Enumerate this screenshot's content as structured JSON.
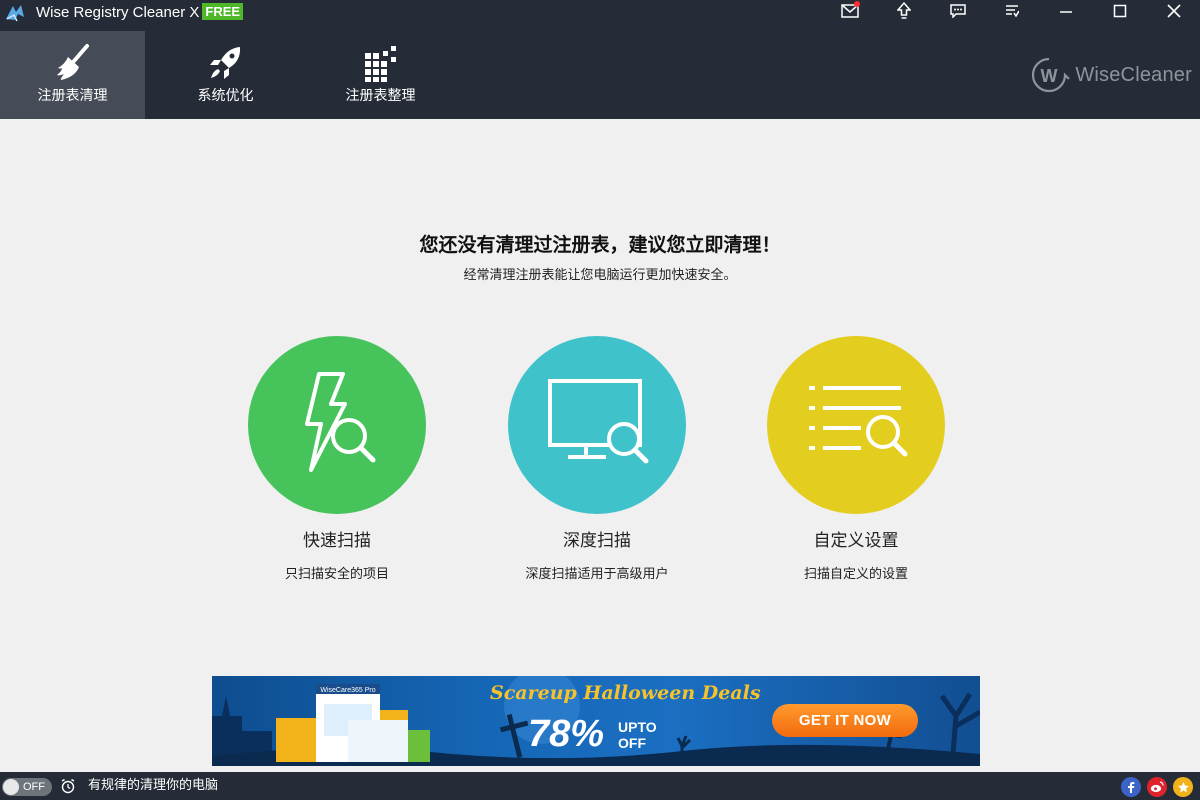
{
  "app": {
    "title": "Wise Registry Cleaner X",
    "badge": "FREE"
  },
  "window_controls": [
    "mail-icon",
    "upgrade-icon",
    "feedback-icon",
    "menu-icon",
    "minimize-icon",
    "maximize-icon",
    "close-icon"
  ],
  "tabs": [
    {
      "label": "注册表清理",
      "icon": "broom-icon",
      "active": true
    },
    {
      "label": "系统优化",
      "icon": "rocket-icon",
      "active": false
    },
    {
      "label": "注册表整理",
      "icon": "defrag-blocks-icon",
      "active": false
    }
  ],
  "brand": {
    "letter": "W",
    "name": "WiseCleaner"
  },
  "main": {
    "headline": "您还没有清理过注册表，建议您立即清理！",
    "subline": "经常清理注册表能让您电脑运行更加快速安全。"
  },
  "scan_options": [
    {
      "title": "快速扫描",
      "desc": "只扫描安全的项目",
      "color": "#46c35a",
      "icon": "fast-scan-icon"
    },
    {
      "title": "深度扫描",
      "desc": "深度扫描适用于高级用户",
      "color": "#3fc2c9",
      "icon": "deep-scan-icon"
    },
    {
      "title": "自定义设置",
      "desc": "扫描自定义的设置",
      "color": "#e3cd1f",
      "icon": "custom-scan-icon"
    }
  ],
  "banner": {
    "headline": "Scareup Halloween Deals",
    "percent": "78%",
    "upto": "UPTO",
    "off": "OFF",
    "cta": "GET IT NOW",
    "product_label": "WiseCare365 Pro"
  },
  "status": {
    "toggle": "OFF",
    "text": "有规律的清理你的电脑"
  },
  "colors": {
    "header_bg": "#252c37",
    "active_tab": "#454c57",
    "body_bg": "#f0f0f0",
    "free_badge": "#4fb82a"
  }
}
